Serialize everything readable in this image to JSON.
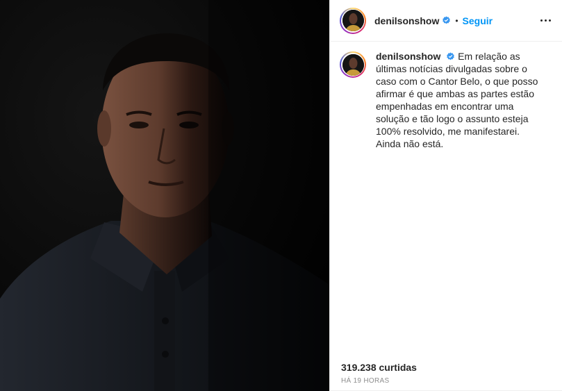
{
  "post": {
    "username": "denilsonshow",
    "follow_label": "Seguir",
    "separator": "•",
    "caption": "Em relação as últimas notícias divulgadas sobre o caso com o Cantor Belo, o que posso afirmar é que ambas as partes estão empenhadas em encontrar uma solução e tão logo o assunto esteja 100% resolvido, me manifestarei. Ainda não está.",
    "likes": "319.238 curtidas",
    "time": "HÁ 19 HORAS"
  },
  "icons": {
    "verified": "verified-badge-icon",
    "more": "more-options-icon"
  },
  "colors": {
    "accent": "#0095f6",
    "verified": "#3897f0",
    "media_bg": "#050505"
  }
}
